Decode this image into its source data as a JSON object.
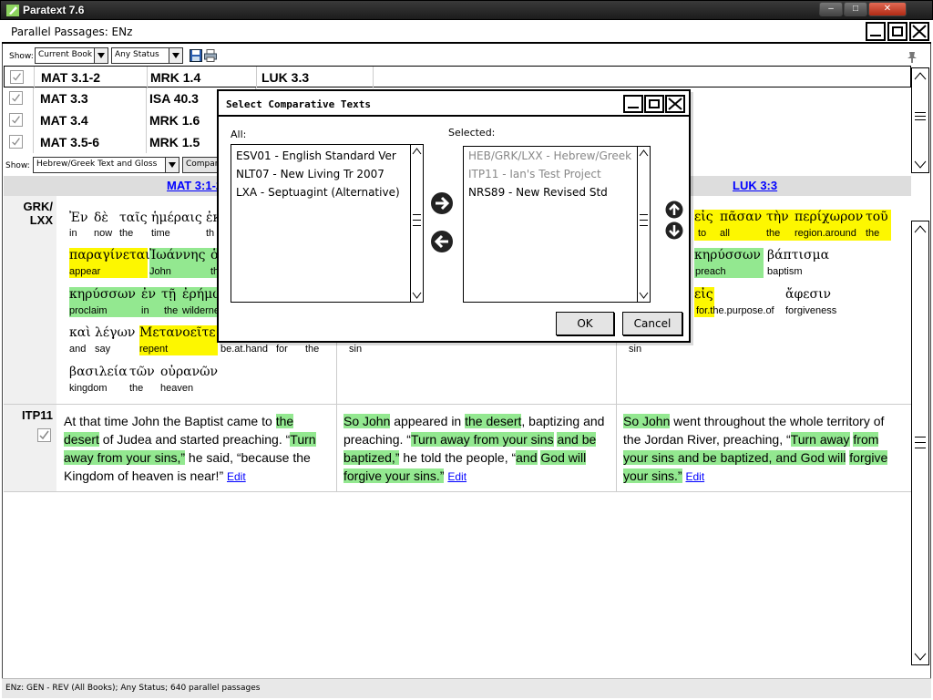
{
  "os_window": {
    "title": "Paratext 7.6"
  },
  "panel": {
    "title": "Parallel Passages: ENz"
  },
  "toolbar": {
    "show_label": "Show:",
    "book_filter": "Current Book",
    "status_filter": "Any Status",
    "save_icon": "save-icon",
    "print_icon": "print-icon"
  },
  "passages": [
    {
      "checked": true,
      "refs": [
        "MAT 3.1-2",
        "MRK 1.4",
        "LUK 3.3"
      ]
    },
    {
      "checked": true,
      "refs": [
        "MAT 3.3",
        "ISA 40.3",
        ""
      ]
    },
    {
      "checked": true,
      "refs": [
        "MAT 3.4",
        "MRK 1.6",
        ""
      ]
    },
    {
      "checked": true,
      "refs": [
        "MAT 3.5-6",
        "MRK 1.5",
        ""
      ]
    }
  ],
  "filter_bar": {
    "show_label": "Show:",
    "text_filter": "Hebrew/Greek Text and Gloss",
    "compare_button": "Compare Texts..."
  },
  "columns": {
    "col1": "MAT 3:1-2",
    "col3": "LUK 3:3"
  },
  "rows": {
    "grk_label_1": "GRK/",
    "grk_label_2": "LXX",
    "itp_label": "ITP11"
  },
  "greek_col1": [
    {
      "word": "Ἐν",
      "gloss": "in"
    },
    {
      "word": "δὲ",
      "gloss": "now"
    },
    {
      "word": "ταῖς",
      "gloss": "the"
    },
    {
      "word": "ἡμέραις",
      "gloss": "time"
    },
    {
      "word": "ἐκ",
      "gloss": "th"
    },
    {
      "word": "παραγίνεται",
      "gloss": "appear"
    },
    {
      "word": "Ἰωάννης",
      "gloss": "John"
    },
    {
      "word": "ὁ",
      "gloss": "th"
    },
    {
      "word": "κηρύσσων",
      "gloss": "proclaim"
    },
    {
      "word": "ἐν",
      "gloss": "in"
    },
    {
      "word": "τῇ",
      "gloss": "the"
    },
    {
      "word": "ἐρήμῳ",
      "gloss": "wilderne"
    },
    {
      "word": "καὶ",
      "gloss": "and"
    },
    {
      "word": "λέγων",
      "gloss": "say"
    },
    {
      "word": "Μετανοεῖτε",
      "gloss": "repent"
    },
    {
      "word": "",
      "gloss": "be.at.hand"
    },
    {
      "word": "",
      "gloss": "for"
    },
    {
      "word": "",
      "gloss": "the"
    },
    {
      "word": "βασιλεία",
      "gloss": "kingdom"
    },
    {
      "word": "τῶν",
      "gloss": "the"
    },
    {
      "word": "οὐρανῶν",
      "gloss": "heaven"
    }
  ],
  "greek_col2": [
    {
      "word": "",
      "gloss": "sin"
    }
  ],
  "greek_col3": [
    {
      "word": "εἰς",
      "gloss": "to"
    },
    {
      "word": "πᾶσαν",
      "gloss": "all"
    },
    {
      "word": "τὴν",
      "gloss": "the"
    },
    {
      "word": "περίχωρον",
      "gloss": "region.around"
    },
    {
      "word": "τοῦ",
      "gloss": "the"
    },
    {
      "word": "κηρύσσων",
      "gloss": "preach"
    },
    {
      "word": "βάπτισμα",
      "gloss": "baptism"
    },
    {
      "word": "εἰς",
      "gloss": "for.the.purpose.of"
    },
    {
      "word": "ἄφεσιν",
      "gloss": "forgiveness"
    },
    {
      "word": "",
      "gloss": "sin"
    }
  ],
  "itp_text": {
    "col1": {
      "p1": "At that time John the Baptist came to ",
      "h1": "the",
      "h2": "desert",
      "p2": " of Judea and started preaching.  “",
      "h3": "Turn",
      "h4": "away from your sins,”",
      "p3": " he said, “because the Kingdom of heaven is near!”",
      "edit": "Edit"
    },
    "col2": {
      "h1": "So John",
      "p1": " appeared in ",
      "h2": "the desert",
      "p2": ", baptizing and preaching. “",
      "h3": "Turn away from your sins",
      "h4": "and be baptized,”",
      "p3": " he told the people, “",
      "h5": "and",
      "h6": "God will forgive your sins.”",
      "edit": "Edit"
    },
    "col3": {
      "h1": "So John",
      "p1": " went throughout the whole territory of the Jordan River, preaching, “",
      "h2": "Turn away",
      "h3": "from your sins and be baptized, and God will",
      "h4": "forgive your sins.”",
      "edit": "Edit"
    }
  },
  "status": "ENz: GEN - REV (All Books); Any Status; 640 parallel passages",
  "dialog": {
    "title": "Select Comparative Texts",
    "all_label": "All:",
    "selected_label": "Selected:",
    "all_items": [
      "ESV01 - English Standard Ver",
      "NLT07 - New Living Tr 2007",
      "LXA - Septuagint (Alternative)"
    ],
    "selected_items": [
      {
        "text": "HEB/GRK/LXX - Hebrew/Greek",
        "dim": true
      },
      {
        "text": "ITP11 - Ian's Test Project",
        "dim": true
      },
      {
        "text": "NRS89 - New Revised Std",
        "dim": false
      }
    ],
    "ok": "OK",
    "cancel": "Cancel",
    "add_icon": "arrow-right-icon",
    "remove_icon": "arrow-left-icon",
    "move_up_icon": "arrow-up-icon",
    "move_down_icon": "arrow-down-icon"
  },
  "colors": {
    "highlight_yellow": "#fdf700",
    "highlight_green": "#93e890",
    "link": "#0000ff"
  }
}
